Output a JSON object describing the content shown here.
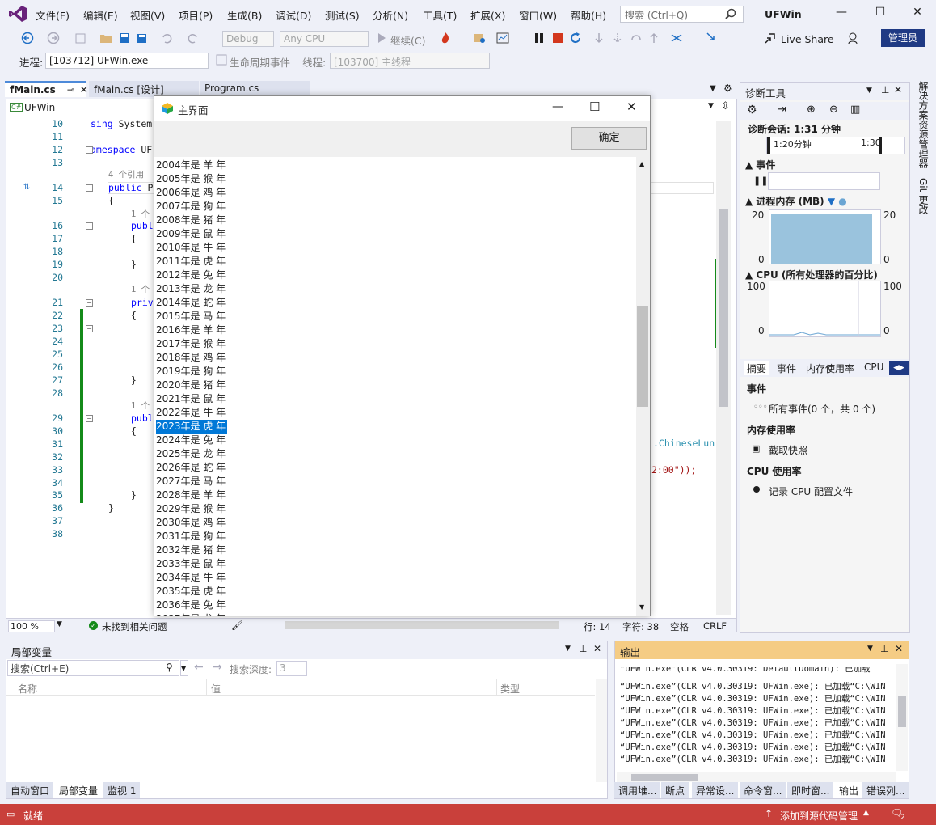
{
  "menu": {
    "items": [
      "文件(F)",
      "编辑(E)",
      "视图(V)",
      "项目(P)",
      "生成(B)",
      "调试(D)",
      "测试(S)",
      "分析(N)",
      "工具(T)",
      "扩展(X)",
      "窗口(W)",
      "帮助(H)"
    ],
    "search_placeholder": "搜索 (Ctrl+Q)",
    "app_name": "UFWin"
  },
  "toolbar": {
    "config": "Debug",
    "platform": "Any CPU",
    "continue_label": "继续(C)",
    "live_share": "Live Share",
    "admin": "管理员",
    "process_label": "进程:",
    "process_value": "[103712] UFWin.exe",
    "lifecycle": "生命周期事件",
    "thread_label": "线程:",
    "thread_value": "[103700] 主线程"
  },
  "tabs": {
    "fmain": "fMain.cs",
    "design": "fMain.cs [设计]",
    "program": "Program.cs"
  },
  "editor": {
    "nav_project": "UFWin",
    "lines": [
      {
        "n": "10",
        "text": "sing System"
      },
      {
        "n": "11",
        "text": ""
      },
      {
        "n": "12",
        "text": "amespace UF"
      },
      {
        "n": "13",
        "text": ""
      },
      {
        "n": "",
        "text": "4 个引用"
      },
      {
        "n": "14",
        "text": "public P"
      },
      {
        "n": "15",
        "text": "{"
      },
      {
        "n": "",
        "text": "1 个"
      },
      {
        "n": "16",
        "text": "publ"
      },
      {
        "n": "17",
        "text": "{"
      },
      {
        "n": "18",
        "text": ""
      },
      {
        "n": "19",
        "text": "}"
      },
      {
        "n": "20",
        "text": ""
      },
      {
        "n": "",
        "text": "1 个"
      },
      {
        "n": "21",
        "text": "priv"
      },
      {
        "n": "22",
        "text": "{"
      },
      {
        "n": "23",
        "text": ""
      },
      {
        "n": "24",
        "text": ""
      },
      {
        "n": "25",
        "text": ""
      },
      {
        "n": "26",
        "text": ""
      },
      {
        "n": "27",
        "text": "}"
      },
      {
        "n": "28",
        "text": ""
      },
      {
        "n": "",
        "text": "1 个"
      },
      {
        "n": "29",
        "text": "publ"
      },
      {
        "n": "30",
        "text": "{"
      },
      {
        "n": "31",
        "text": ""
      },
      {
        "n": "32",
        "text": ""
      },
      {
        "n": "33",
        "text": ""
      },
      {
        "n": "34",
        "text": ""
      },
      {
        "n": "35",
        "text": "}"
      },
      {
        "n": "36",
        "text": "}"
      },
      {
        "n": "37",
        "text": ""
      },
      {
        "n": "38",
        "text": ""
      }
    ],
    "right_code_1": ".ChineseLun",
    "right_code_2": "2:00\"));",
    "zoom": "100 %",
    "issues": "未找到相关问题",
    "row": "行: 14",
    "col": "字符: 38",
    "ws": "空格",
    "eol": "CRLF"
  },
  "dialog": {
    "title": "主界面",
    "ok": "确定",
    "items": [
      "2004年是 羊 年",
      "2005年是 猴 年",
      "2006年是 鸡 年",
      "2007年是 狗 年",
      "2008年是 猪 年",
      "2009年是 鼠 年",
      "2010年是 牛 年",
      "2011年是 虎 年",
      "2012年是 兔 年",
      "2013年是 龙 年",
      "2014年是 蛇 年",
      "2015年是 马 年",
      "2016年是 羊 年",
      "2017年是 猴 年",
      "2018年是 鸡 年",
      "2019年是 狗 年",
      "2020年是 猪 年",
      "2021年是 鼠 年",
      "2022年是 牛 年",
      "2023年是 虎 年",
      "2024年是 兔 年",
      "2025年是 龙 年",
      "2026年是 蛇 年",
      "2027年是 马 年",
      "2028年是 羊 年",
      "2029年是 猴 年",
      "2030年是 鸡 年",
      "2031年是 狗 年",
      "2032年是 猪 年",
      "2033年是 鼠 年",
      "2034年是 牛 年",
      "2035年是 虎 年",
      "2036年是 兔 年"
    ],
    "selected_index": 19
  },
  "diag": {
    "title": "诊断工具",
    "session": "诊断会话: 1:31 分钟",
    "t1": "1:20分钟",
    "t2": "1:30",
    "events": "事件",
    "memory": "进程内存 (MB)",
    "mem_max": "20",
    "mem_min": "0",
    "cpu": "CPU (所有处理器的百分比)",
    "cpu_max": "100",
    "cpu_min": "0",
    "tabs": [
      "摘要",
      "事件",
      "内存使用率",
      "CPU"
    ],
    "sec_events": "事件",
    "all_events": "所有事件(0 个，共 0 个)",
    "sec_mem": "内存使用率",
    "snapshot": "截取快照",
    "sec_cpu": "CPU 使用率",
    "record_cpu": "记录 CPU 配置文件"
  },
  "side_tabs": [
    "解决方案资源管理器",
    "Git 更改"
  ],
  "locals": {
    "title": "局部变量",
    "search": "搜索(Ctrl+E)",
    "depth_label": "搜索深度:",
    "depth": "3",
    "col_name": "名称",
    "col_value": "值",
    "col_type": "类型",
    "tabs": [
      "自动窗口",
      "局部变量",
      "监视 1"
    ]
  },
  "output": {
    "title": "输出",
    "lines": [
      "“UFWin.exe”(CLR v4.0.30319: DefaultDomain): 已加载",
      "“UFWin.exe”(CLR v4.0.30319: UFWin.exe): 已加载“C:\\WIN",
      "“UFWin.exe”(CLR v4.0.30319: UFWin.exe): 已加载“C:\\WIN",
      "“UFWin.exe”(CLR v4.0.30319: UFWin.exe): 已加载“C:\\WIN",
      "“UFWin.exe”(CLR v4.0.30319: UFWin.exe): 已加载“C:\\WIN",
      "“UFWin.exe”(CLR v4.0.30319: UFWin.exe): 已加载“C:\\WIN",
      "“UFWin.exe”(CLR v4.0.30319: UFWin.exe): 已加载“C:\\WIN",
      "“UFWin.exe”(CLR v4.0.30319: UFWin.exe): 已加载“C:\\WIN"
    ],
    "tabs": [
      "调用堆...",
      "断点",
      "异常设...",
      "命令窗...",
      "即时窗...",
      "输出",
      "错误列..."
    ]
  },
  "status": {
    "ready": "就绪",
    "source_control": "添加到源代码管理",
    "notifications": "2"
  }
}
